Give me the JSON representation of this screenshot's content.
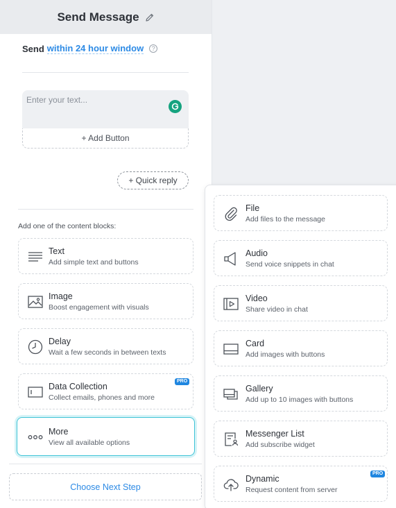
{
  "header": {
    "title": "Send Message",
    "edit_icon": "pencil-icon"
  },
  "send_window": {
    "prefix": "Send",
    "link": "within 24 hour window",
    "help": "?"
  },
  "composer": {
    "placeholder": "Enter your text...",
    "add_button_label": "+ Add Button",
    "assistant_icon": "grammarly-icon"
  },
  "quick_reply_label": "+ Quick reply",
  "blocks_label": "Add one of the content blocks:",
  "blocks": [
    {
      "title": "Text",
      "subtitle": "Add simple text and buttons",
      "icon": "text-lines-icon"
    },
    {
      "title": "Image",
      "subtitle": "Boost engagement with visuals",
      "icon": "image-icon"
    },
    {
      "title": "Delay",
      "subtitle": "Wait a few seconds in between texts",
      "icon": "clock-icon"
    },
    {
      "title": "Data Collection",
      "subtitle": "Collect emails, phones and more",
      "icon": "input-field-icon",
      "badge": "PRO"
    },
    {
      "title": "More",
      "subtitle": "View all available options",
      "icon": "more-dots-icon",
      "selected": true
    }
  ],
  "next_step_label": "Choose Next Step",
  "more_menu": [
    {
      "title": "File",
      "subtitle": "Add files to the message",
      "icon": "paperclip-icon"
    },
    {
      "title": "Audio",
      "subtitle": "Send voice snippets in chat",
      "icon": "speaker-icon"
    },
    {
      "title": "Video",
      "subtitle": "Share video in chat",
      "icon": "video-icon"
    },
    {
      "title": "Card",
      "subtitle": "Add images with buttons",
      "icon": "card-icon"
    },
    {
      "title": "Gallery",
      "subtitle": "Add up to 10 images with buttons",
      "icon": "gallery-icon"
    },
    {
      "title": "Messenger List",
      "subtitle": "Add subscribe widget",
      "icon": "messenger-list-icon"
    },
    {
      "title": "Dynamic",
      "subtitle": "Request content from server",
      "icon": "cloud-upload-icon",
      "badge": "PRO"
    }
  ],
  "colors": {
    "accent": "#2c8ae5",
    "active_border": "#3dc3d6",
    "pro_badge": "#1f86e0",
    "grammarly": "#15a37f"
  }
}
